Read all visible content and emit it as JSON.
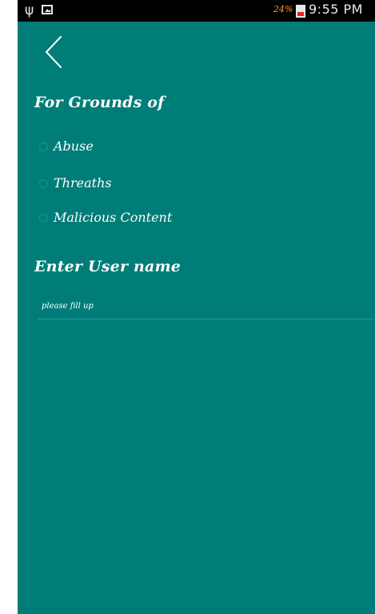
{
  "status_bar": {
    "usb_icon": "usb-icon",
    "gallery_icon": "gallery-icon",
    "battery_percent": "24%",
    "battery_icon": "battery-low-icon",
    "time": "9:55 PM"
  },
  "navigation": {
    "back_icon": "chevron-left-icon"
  },
  "report_form": {
    "grounds_title": "For Grounds of",
    "grounds_options": [
      {
        "label": "Abuse",
        "selected": false
      },
      {
        "label": "Threaths",
        "selected": false
      },
      {
        "label": "Malicious Content",
        "selected": false
      }
    ],
    "username_title": "Enter User name",
    "username_value": "",
    "username_placeholder": "please fill up"
  },
  "colors": {
    "background": "#007d78",
    "status_bar": "#000000",
    "text": "#ffffff",
    "battery_text": "#ff9a22",
    "battery_low": "#e82424",
    "input_line": "#2a9891"
  }
}
